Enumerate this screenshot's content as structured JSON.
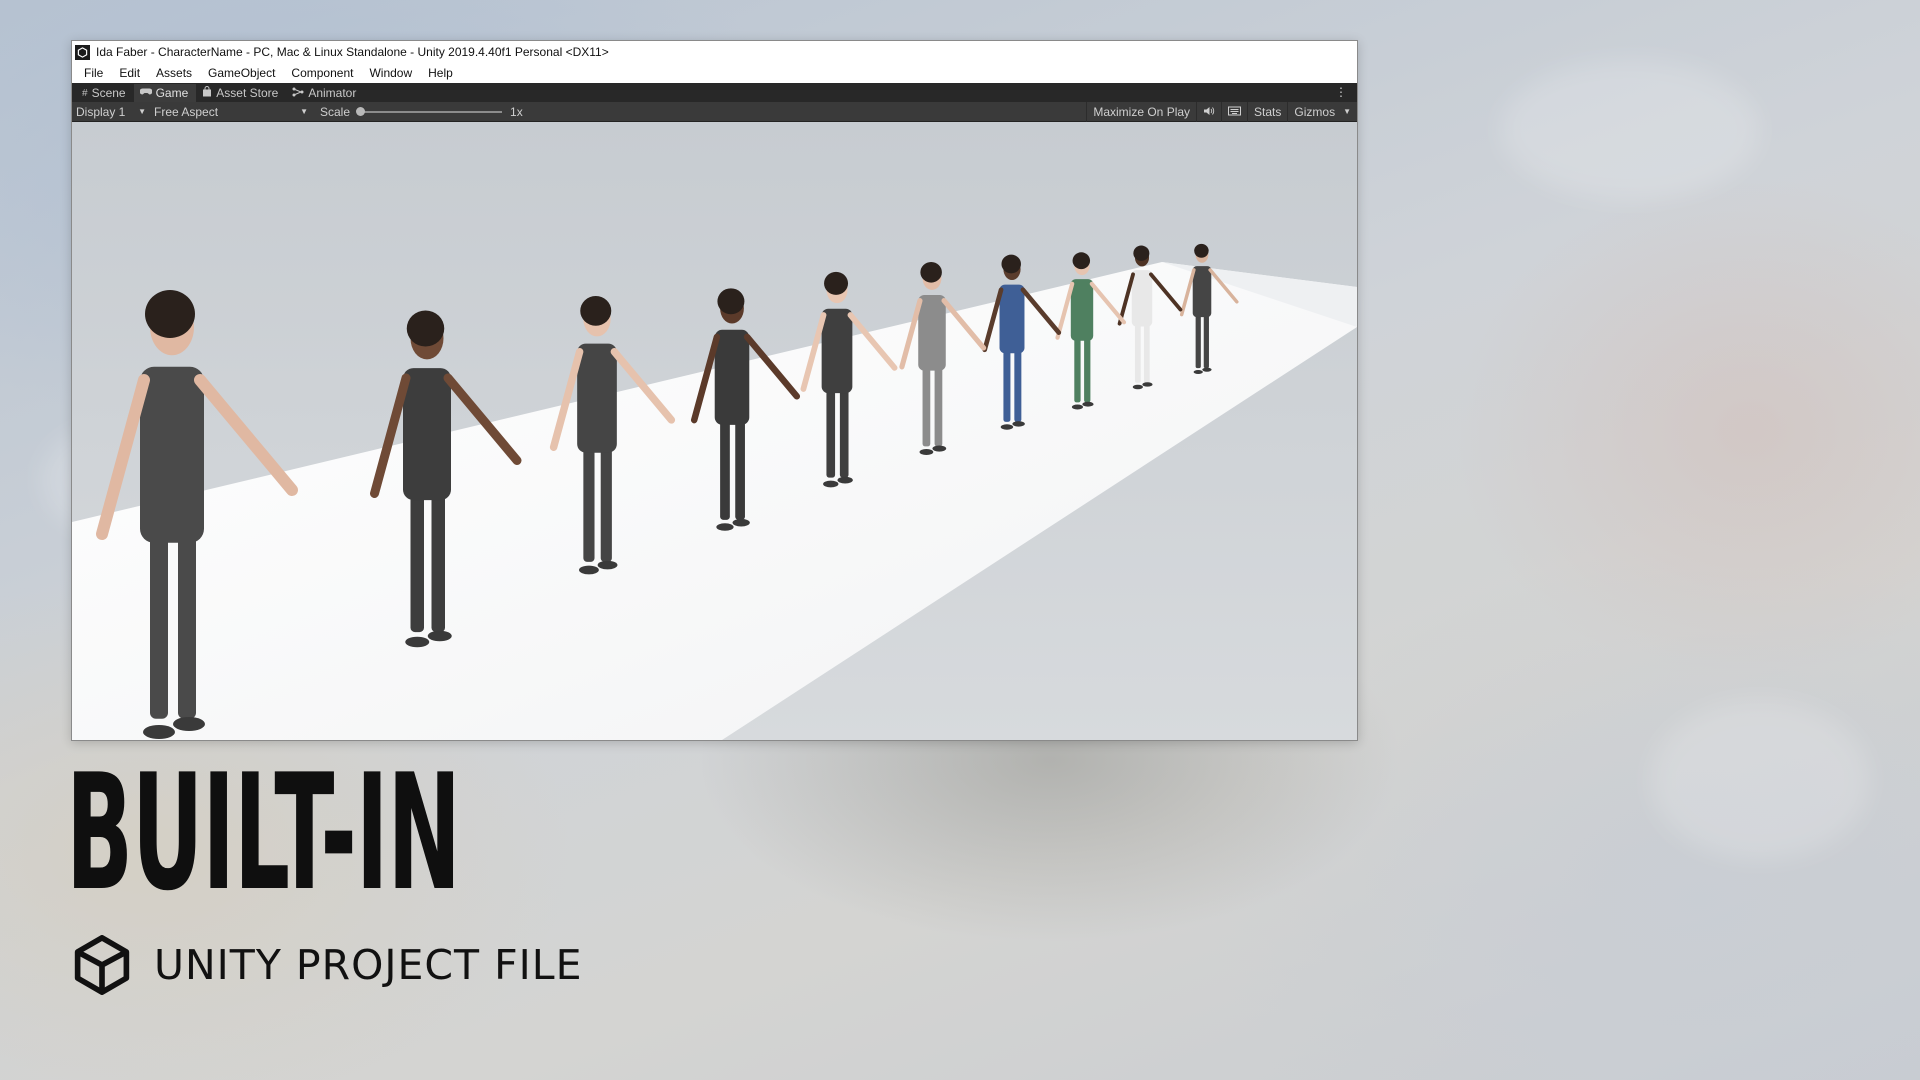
{
  "window": {
    "title": "Ida Faber - CharacterName - PC, Mac & Linux Standalone - Unity 2019.4.40f1 Personal <DX11>",
    "menu": [
      "File",
      "Edit",
      "Assets",
      "GameObject",
      "Component",
      "Window",
      "Help"
    ]
  },
  "tabs": [
    {
      "label": "Scene",
      "icon": "scene-grid-icon"
    },
    {
      "label": "Game",
      "icon": "gamepad-icon"
    },
    {
      "label": "Asset Store",
      "icon": "shopping-bag-icon"
    },
    {
      "label": "Animator",
      "icon": "animator-icon"
    }
  ],
  "active_tab": "Game",
  "toolbar": {
    "display": "Display 1",
    "aspect": "Free Aspect",
    "scale_label": "Scale",
    "scale_value": "1x",
    "maximize": "Maximize On Play",
    "stats": "Stats",
    "gizmos": "Gizmos"
  },
  "viewport": {
    "character_count": 10,
    "outfit_colors": [
      "#4a4a4a",
      "#3d3d3d",
      "#454545",
      "#3a3a3a",
      "#3f3f3f",
      "#8c8c8c",
      "#3f5f96",
      "#4f8060",
      "#e8e8e8",
      "#454545"
    ]
  },
  "overlay": {
    "headline": "BUILT-IN",
    "subtitle": "UNITY PROJECT FILE"
  },
  "colors": {
    "tab_bar": "#282828",
    "toolbar": "#3a3a3a",
    "floor": "#ffffff",
    "wall": "#cfd3d7"
  }
}
